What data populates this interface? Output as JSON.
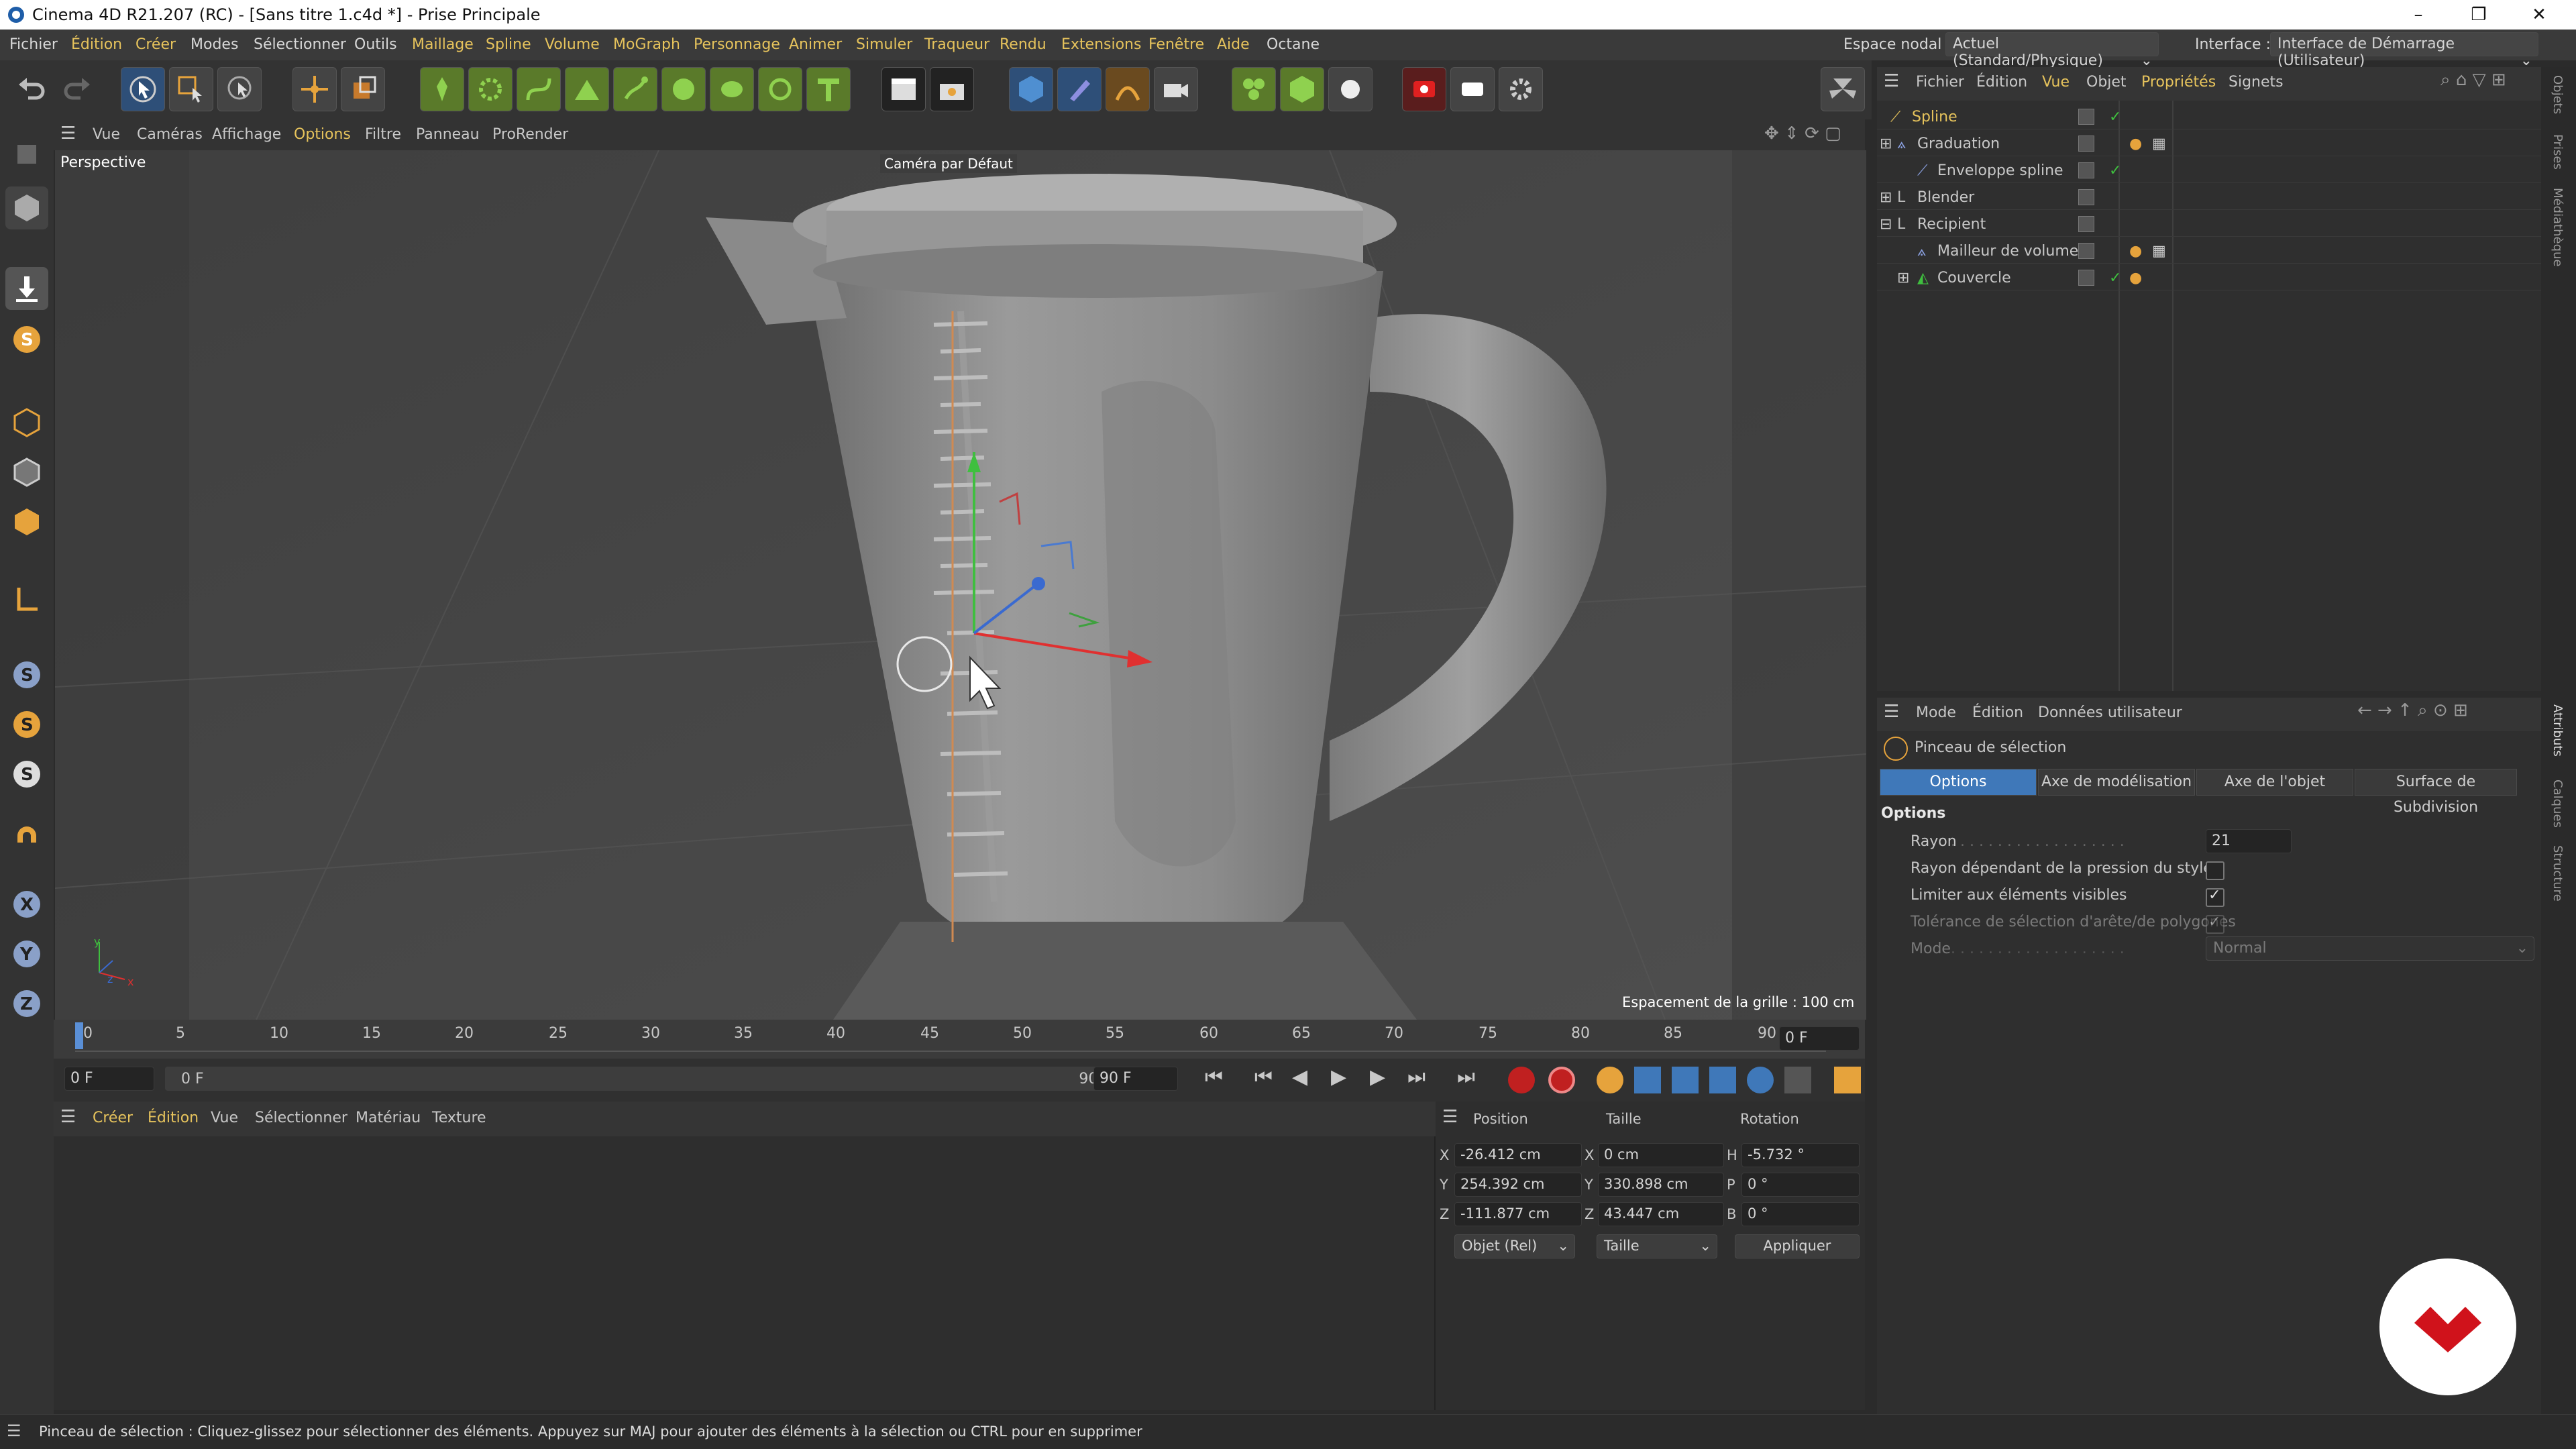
{
  "window": {
    "title": "Cinema 4D R21.207 (RC) - [Sans titre 1.c4d *] - Prise Principale",
    "minimize": "–",
    "maximize": "❐",
    "close": "✕"
  },
  "menubar": {
    "items": [
      "Fichier",
      "Édition",
      "Créer",
      "Modes",
      "Sélectionner",
      "Outils",
      "Maillage",
      "Spline",
      "Volume",
      "MoGraph",
      "Personnage",
      "Animer",
      "Simuler",
      "Traqueur",
      "Rendu",
      "Extensions",
      "Fenêtre",
      "Aide",
      "Octane"
    ],
    "nodal_label": "Espace nodal :",
    "nodal_value": "Actuel (Standard/Physique)",
    "interface_label": "Interface :",
    "interface_value": "Interface de Démarrage (Utilisateur)"
  },
  "viewport": {
    "menu": [
      "Vue",
      "Caméras",
      "Affichage",
      "Options",
      "Filtre",
      "Panneau",
      "ProRender"
    ],
    "label": "Perspective",
    "camera": "Caméra par Défaut",
    "grid_spacing": "Espacement de la grille : 100 cm",
    "axis_y": "y",
    "axis_x": "x",
    "axis_z": "z"
  },
  "timeline": {
    "ticks": [
      "0",
      "5",
      "10",
      "15",
      "20",
      "25",
      "30",
      "35",
      "40",
      "45",
      "50",
      "55",
      "60",
      "65",
      "70",
      "75",
      "80",
      "85",
      "90"
    ],
    "current_frame": "0 F",
    "start_frame": "0 F",
    "range_start": "0 F",
    "range_end": "90 F",
    "end_frame": "90 F"
  },
  "material_panel": {
    "menu": [
      "Créer",
      "Édition",
      "Vue",
      "Sélectionner",
      "Matériau",
      "Texture"
    ]
  },
  "coords": {
    "headers": [
      "Position",
      "Taille",
      "Rotation"
    ],
    "rows": [
      {
        "axis": "X",
        "pos": "-26.412 cm",
        "size_axis": "X",
        "size": "0 cm",
        "rot_axis": "H",
        "rot": "-5.732 °"
      },
      {
        "axis": "Y",
        "pos": "254.392 cm",
        "size_axis": "Y",
        "size": "330.898 cm",
        "rot_axis": "P",
        "rot": "0 °"
      },
      {
        "axis": "Z",
        "pos": "-111.877 cm",
        "size_axis": "Z",
        "size": "43.447 cm",
        "rot_axis": "B",
        "rot": "0 °"
      }
    ],
    "mode": "Objet (Rel)",
    "size_mode": "Taille",
    "apply": "Appliquer"
  },
  "objects_panel": {
    "menu": [
      "Fichier",
      "Édition",
      "Vue",
      "Objet",
      "Propriétés",
      "Signets"
    ],
    "items": [
      {
        "name": "Spline",
        "indent": 0
      },
      {
        "name": "Graduation",
        "indent": 0
      },
      {
        "name": "Enveloppe spline",
        "indent": 1
      },
      {
        "name": "Blender",
        "indent": 0
      },
      {
        "name": "Recipient",
        "indent": 0
      },
      {
        "name": "Mailleur de volume",
        "indent": 1
      },
      {
        "name": "Couvercle",
        "indent": 1
      }
    ]
  },
  "attributes_panel": {
    "menu": [
      "Mode",
      "Édition",
      "Données utilisateur"
    ],
    "tool_name": "Pinceau de sélection",
    "tabs": [
      "Options",
      "Axe de modélisation",
      "Axe de l'objet",
      "Surface de Subdivision"
    ],
    "section": "Options",
    "rayon_label": "Rayon",
    "rayon_value": "21",
    "pressure_label": "Rayon dépendant de la pression du stylet",
    "pressure_checked": false,
    "visible_label": "Limiter aux éléments visibles",
    "visible_checked": true,
    "tolerance_label": "Tolérance de sélection d'arête/de polygones",
    "tolerance_checked": true,
    "mode_label": "Mode",
    "mode_value": "Normal"
  },
  "side_tabs": {
    "top": [
      "Objets",
      "Prises",
      "Médiathèque"
    ],
    "bottom": [
      "Attributs",
      "Calques",
      "Structure"
    ]
  },
  "status": {
    "text": "Pinceau de sélection : Cliquez-glissez pour sélectionner des éléments. Appuyez sur MAJ pour ajouter des éléments à la sélection ou CTRL pour en supprimer"
  },
  "colors": {
    "accent": "#e6c35c",
    "selected_tab": "#3f78b9",
    "logo": "#d0121b"
  }
}
